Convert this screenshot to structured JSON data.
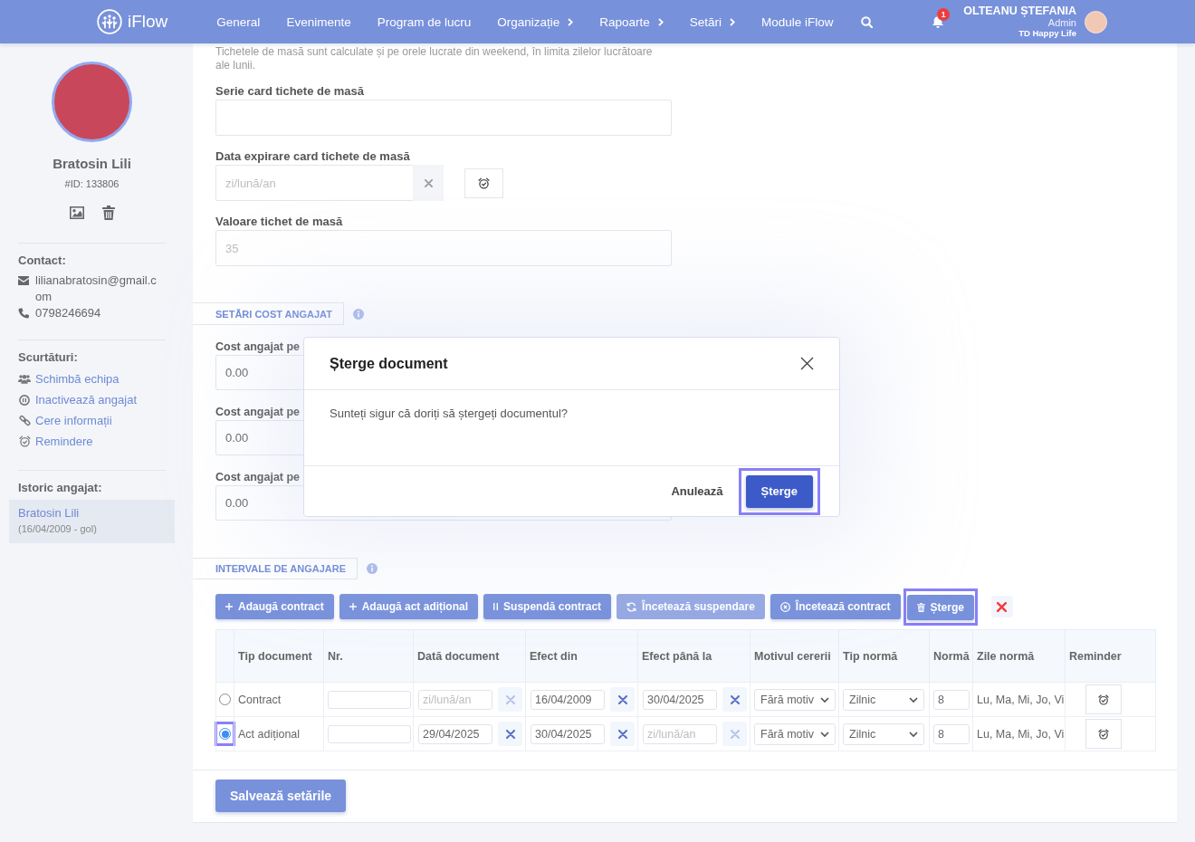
{
  "header": {
    "logo": "iFlow",
    "nav": [
      {
        "label": "General",
        "submenu": false
      },
      {
        "label": "Evenimente",
        "submenu": false
      },
      {
        "label": "Program de lucru",
        "submenu": false
      },
      {
        "label": "Organizație",
        "submenu": true
      },
      {
        "label": "Rapoarte",
        "submenu": true
      },
      {
        "label": "Setări",
        "submenu": true
      },
      {
        "label": "Module iFlow",
        "submenu": false
      }
    ],
    "notifications": "1",
    "user": {
      "name": "OLTEANU ȘTEFANIA",
      "role": "Admin",
      "company": "TD Happy Life"
    }
  },
  "sidebar": {
    "name": "Bratosin Lili",
    "id": "#ID: 133806",
    "contact": {
      "title": "Contact:",
      "email": "lilianabratosin@gmail.com",
      "phone": "0798246694"
    },
    "shortcuts": {
      "title": "Scurtături:",
      "items": [
        "Schimbă echipa",
        "Inactivează angajat",
        "Cere informații",
        "Remindere"
      ]
    },
    "history": {
      "title": "Istoric angajat:",
      "items": [
        {
          "name": "Bratosin Lili",
          "period": "(16/04/2009 - gol)",
          "selected": true
        }
      ]
    }
  },
  "meal_tickets": {
    "note": "Tichetele de masă sunt calculate și pe orele lucrate din weekend, în limita zilelor lucrătoare ale lunii.",
    "fields": [
      {
        "kind": "text",
        "label": "Serie card tichete de masă"
      },
      {
        "kind": "date",
        "label": "Data expirare card tichete de masă",
        "placeholder": "zi/lună/an"
      },
      {
        "kind": "text",
        "label": "Valoare tichet de masă",
        "placeholder": "35"
      }
    ]
  },
  "cost_settings": {
    "tab": "SETĂRI COST ANGAJAT",
    "fields": [
      {
        "label": "Cost angajat pe",
        "value": "0.00"
      },
      {
        "label": "Cost angajat pe",
        "value": "0.00"
      },
      {
        "label": "Cost angajat pe",
        "value": "0.00"
      }
    ]
  },
  "employment_intervals": {
    "tab": "INTERVALE DE ANGAJARE",
    "toolbar": [
      {
        "label": "Adaugă contract",
        "disabled": false,
        "highlighted": false
      },
      {
        "label": "Adaugă act adițional",
        "disabled": false,
        "highlighted": false
      },
      {
        "label": "Suspendă contract",
        "disabled": false,
        "highlighted": false
      },
      {
        "label": "Încetează suspendare",
        "disabled": true,
        "highlighted": false
      },
      {
        "label": "Încetează contract",
        "disabled": false,
        "highlighted": false
      },
      {
        "label": "Șterge",
        "disabled": false,
        "highlighted": true
      }
    ],
    "table": {
      "columns": [
        "Tip document",
        "Nr.",
        "Dată document",
        "Efect din",
        "Efect până la",
        "Motivul cererii",
        "Tip normă",
        "Normă",
        "Zile normă",
        "Reminder"
      ],
      "rows": [
        {
          "selected": false,
          "highlighted": false,
          "type": "Contract",
          "document_date": {
            "placeholder": "zi/lună/an"
          },
          "effective_from": {
            "value": "16/04/2009"
          },
          "effective_to": {
            "value": "30/04/2025"
          },
          "reason": "Fără motiv",
          "norm_type": "Zilnic",
          "norm": "8",
          "norm_days": "Lu, Ma, Mi, Jo, Vi"
        },
        {
          "selected": true,
          "highlighted": true,
          "type": "Act adițional",
          "document_date": {
            "value": "29/04/2025"
          },
          "effective_from": {
            "value": "30/04/2025"
          },
          "effective_to": {
            "placeholder": "zi/lună/an"
          },
          "reason": "Fără motiv",
          "norm_type": "Zilnic",
          "norm": "8",
          "norm_days": "Lu, Ma, Mi, Jo, Vi"
        }
      ]
    }
  },
  "save_button": "Salvează setările",
  "dialog": {
    "title": "Șterge document",
    "message": "Sunteți sigur că doriți să ștergeți documentul?",
    "buttons": [
      {
        "kind": "text",
        "label": "Anulează",
        "highlighted": false
      },
      {
        "kind": "primary",
        "label": "Șterge",
        "highlighted": true
      }
    ]
  }
}
